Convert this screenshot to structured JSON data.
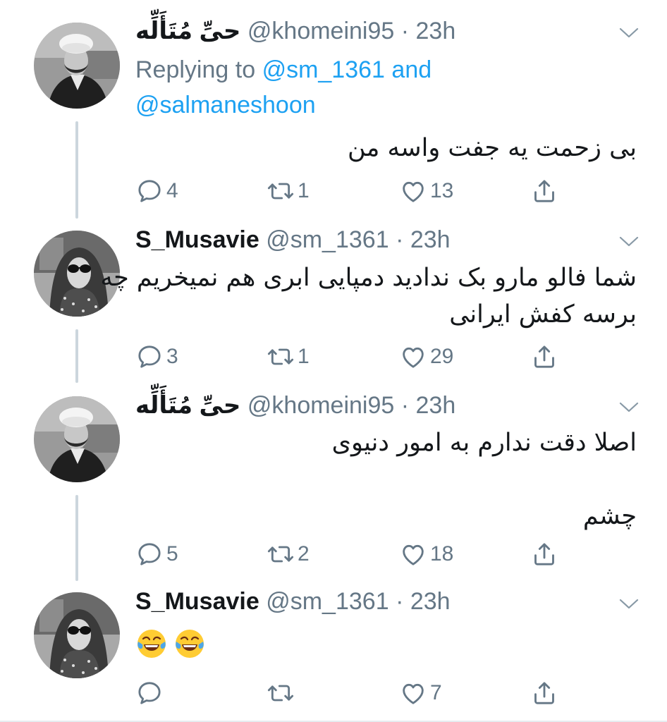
{
  "tweets": [
    {
      "name": "حیِّ مُتَأَلِّه",
      "handle": "@khomeini95",
      "time": "· 23h",
      "replying_prefix": "Replying to",
      "replying_mention1": "@sm_1361",
      "replying_and": "and",
      "replying_mention2": "@salmaneshoon",
      "text_lines": [
        "بی زحمت یه جفت واسه من"
      ],
      "replies": "4",
      "retweets": "1",
      "likes": "13",
      "avatar": "man-with-turban"
    },
    {
      "name": "S_Musavie",
      "handle": "@sm_1361",
      "time": "· 23h",
      "text_lines": [
        "شما فالو مارو بک ندادید دمپایی ابری هم نمیخریم چه",
        "برسه کفش ایرانی"
      ],
      "replies": "3",
      "retweets": "1",
      "likes": "29",
      "avatar": "woman-with-sunglasses"
    },
    {
      "name": "حیِّ مُتَأَلِّه",
      "handle": "@khomeini95",
      "time": "· 23h",
      "text_lines": [
        "اصلا دقت ندارم به امور دنیوی",
        "چشم"
      ],
      "replies": "5",
      "retweets": "2",
      "likes": "18",
      "avatar": "man-with-turban"
    },
    {
      "name": "S_Musavie",
      "handle": "@sm_1361",
      "time": "· 23h",
      "emoji": [
        "face-with-tears-of-joy",
        "face-with-tears-of-joy"
      ],
      "replies": "",
      "retweets": "",
      "likes": "7",
      "avatar": "woman-with-sunglasses"
    }
  ],
  "icons": {
    "reply": "reply-icon",
    "retweet": "retweet-icon",
    "like": "like-icon",
    "share": "share-icon",
    "menu": "chevron-down-icon"
  },
  "colors": {
    "text": "#14171a",
    "secondary": "#657786",
    "link": "#1da1f2",
    "thread_line": "#ccd6dd"
  }
}
